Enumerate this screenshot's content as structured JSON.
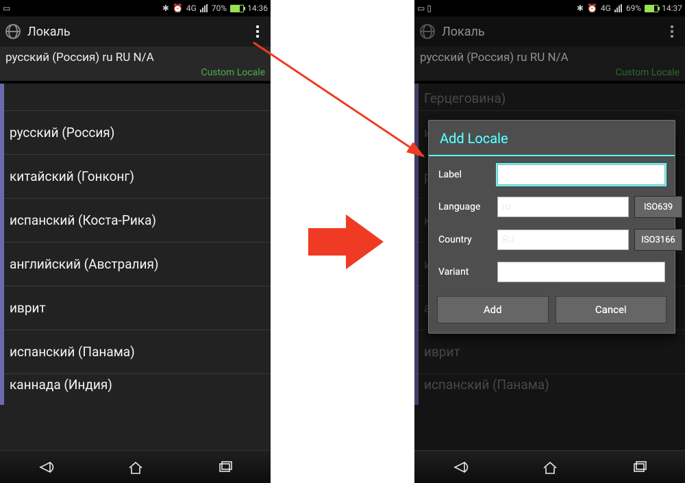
{
  "left": {
    "status": {
      "battery": "70%",
      "time": "14:36",
      "net": "4G"
    },
    "app_title": "Локаль",
    "current_locale": "русский (Россия)  ru RU N/A",
    "custom_label": "Custom Locale",
    "items": [
      "",
      "русский (Россия)",
      "китайский (Гонконг)",
      "испанский (Коста-Рика)",
      "английский (Австралия)",
      "иврит",
      "испанский (Панама)",
      "каннада (Индия)"
    ]
  },
  "right": {
    "status": {
      "battery": "69%",
      "time": "14:37",
      "net": "4G"
    },
    "app_title": "Локаль",
    "current_locale": "русский (Россия)  ru RU N/A",
    "custom_label": "Custom Locale",
    "items": [
      "Герцеговина)",
      "и…",
      "р…",
      "к…",
      "и…",
      "английский (Австралия)",
      "иврит",
      "испанский (Панама)"
    ],
    "dialog": {
      "title": "Add Locale",
      "fields": {
        "label_lab": "Label",
        "language_lab": "Language",
        "language_val": "ru",
        "iso639": "ISO639",
        "country_lab": "Country",
        "country_val": "RU",
        "iso3166": "ISO3166",
        "variant_lab": "Variant"
      },
      "actions": {
        "add": "Add",
        "cancel": "Cancel"
      }
    }
  }
}
